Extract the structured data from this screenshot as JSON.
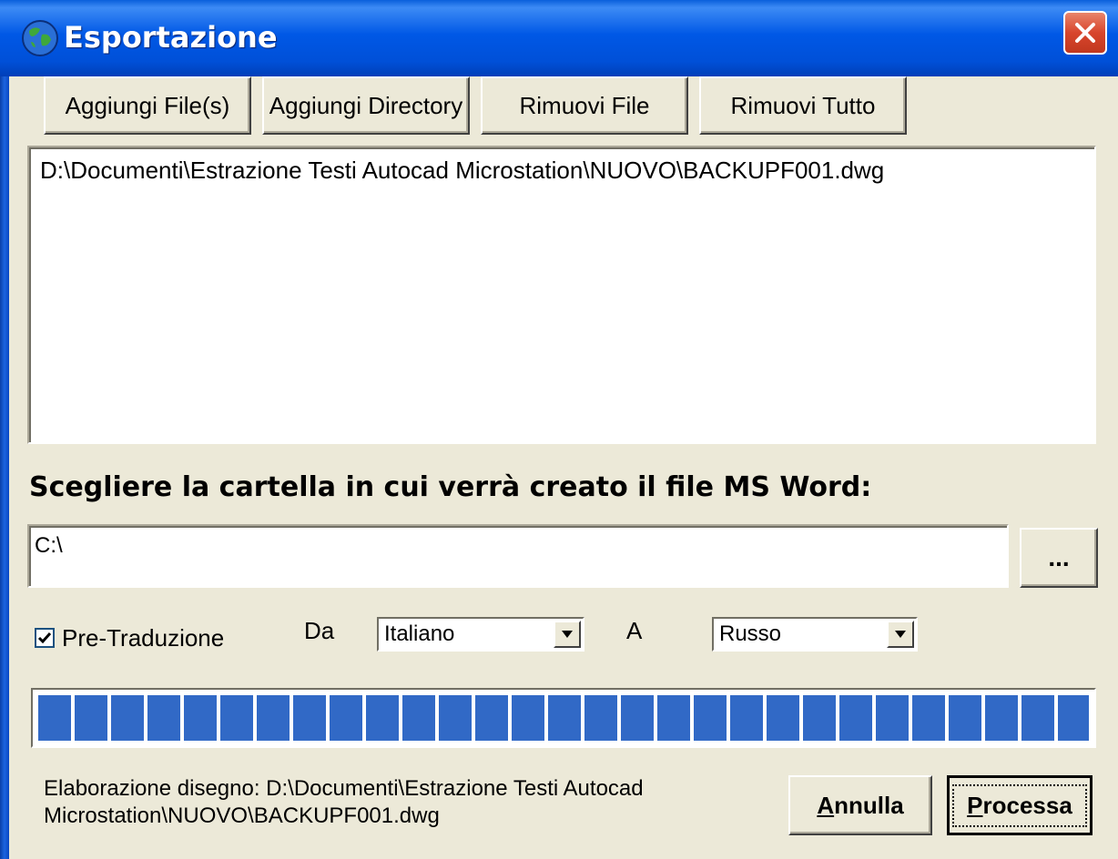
{
  "window": {
    "title": "Esportazione",
    "icon": "globe-icon",
    "close_icon": "close-icon"
  },
  "toolbar": {
    "add_files": "Aggiungi File(s)",
    "add_directory": "Aggiungi Directory",
    "remove_file": "Rimuovi File",
    "remove_all": "Rimuovi Tutto"
  },
  "file_list": {
    "items": [
      "D:\\Documenti\\Estrazione Testi Autocad Microstation\\NUOVO\\BACKUPF001.dwg"
    ]
  },
  "output": {
    "label": "Scegliere la cartella in cui verrà creato il file MS Word:",
    "path": "C:\\",
    "browse_label": "..."
  },
  "options": {
    "pretranslate_label": "Pre-Traduzione",
    "pretranslate_checked": true,
    "from_label": "Da",
    "from_value": "Italiano",
    "to_label": "A",
    "to_value": "Russo"
  },
  "progress": {
    "fraction": 1.0,
    "color": "#3169c6"
  },
  "status": {
    "text": "Elaborazione disegno: D:\\Documenti\\Estrazione Testi Autocad Microstation\\NUOVO\\BACKUPF001.dwg"
  },
  "actions": {
    "cancel_mnemonic": "A",
    "cancel_rest": "nnulla",
    "process_mnemonic": "P",
    "process_rest": "rocessa"
  }
}
